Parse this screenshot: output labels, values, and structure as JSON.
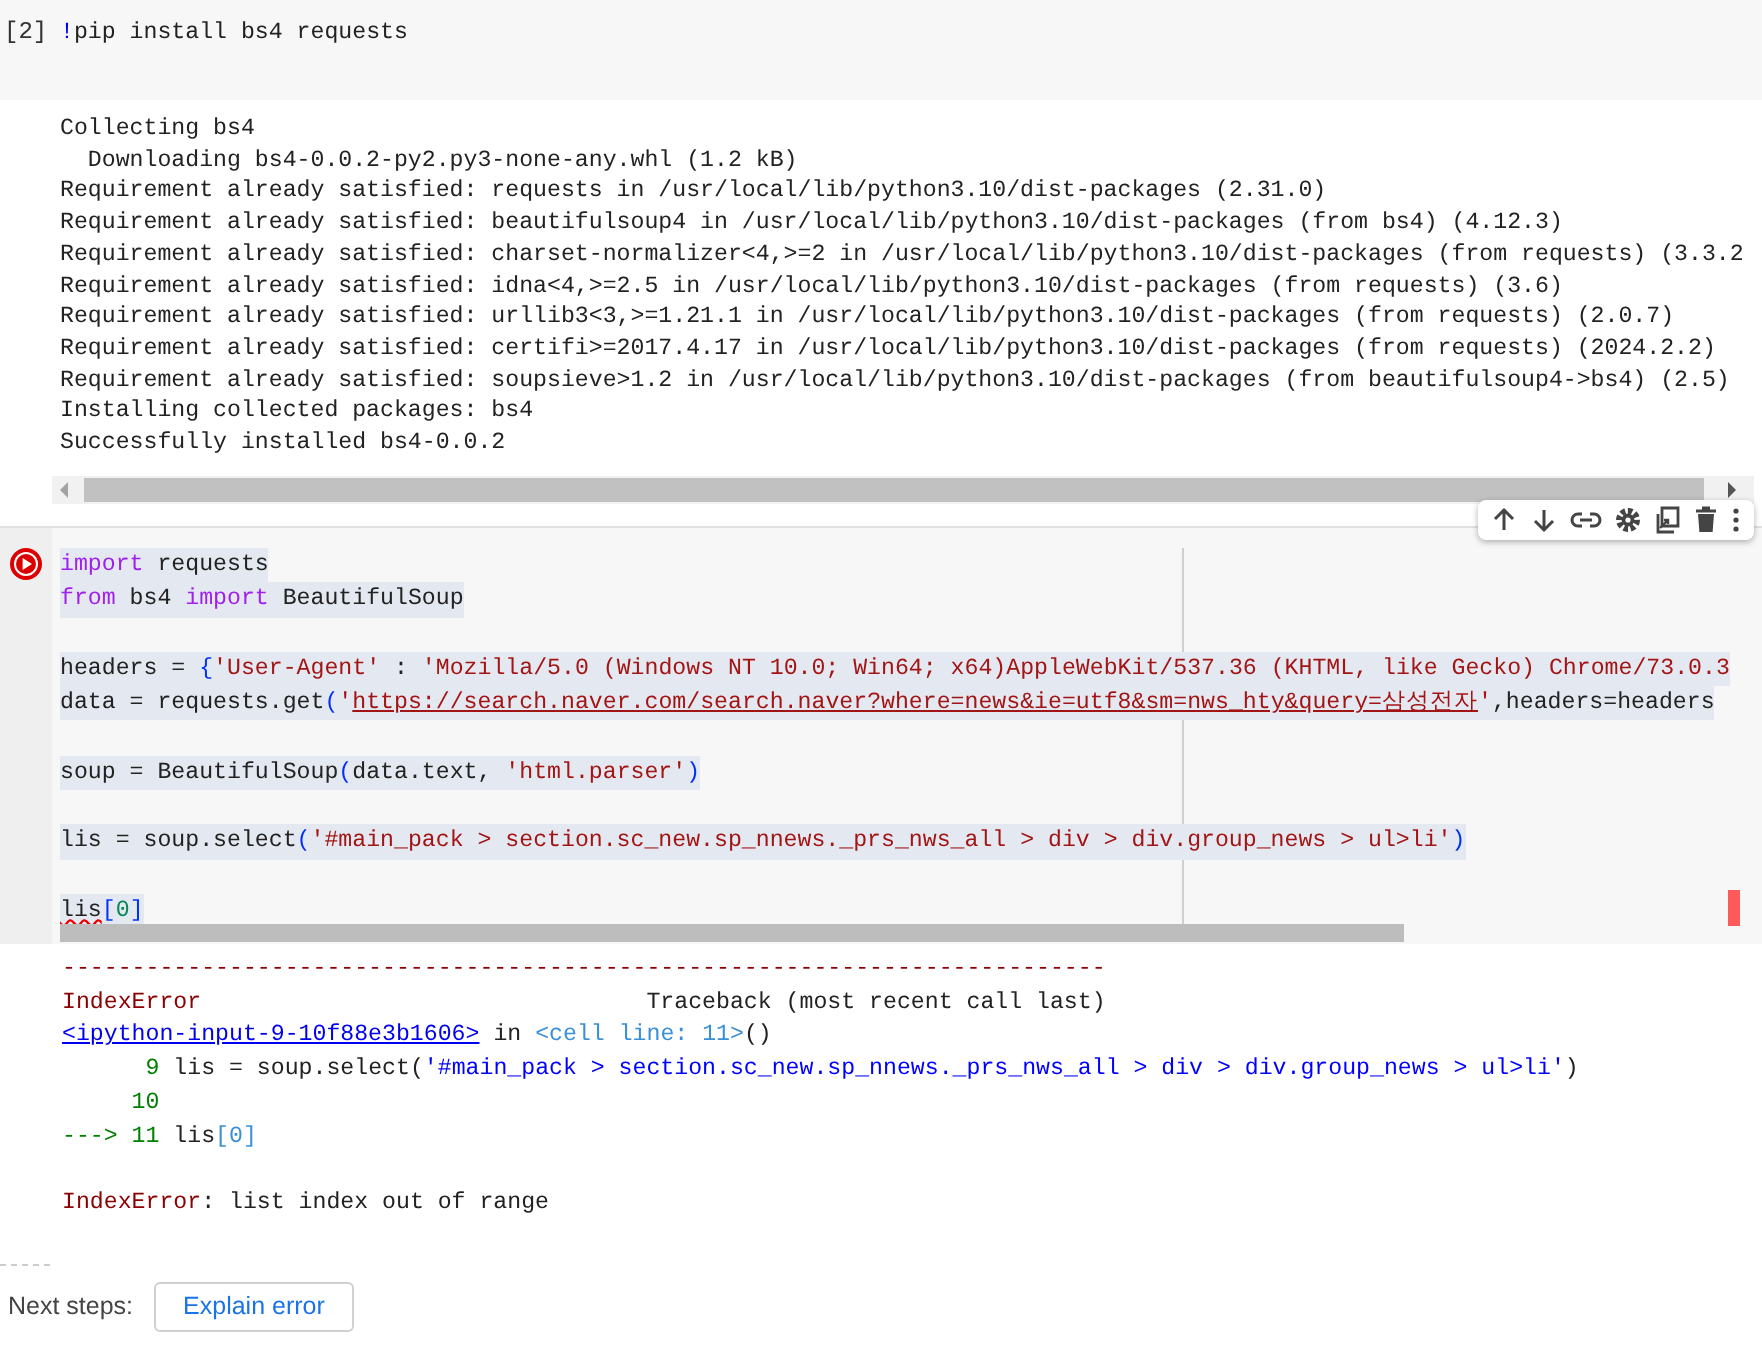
{
  "pip_cell": {
    "execution_count": "[2]",
    "tokens": [
      {
        "kind": "magic",
        "text": "!"
      },
      {
        "kind": "plain",
        "text": "pip install bs4 requests"
      }
    ]
  },
  "pip_output": [
    "Collecting bs4",
    "  Downloading bs4-0.0.2-py2.py3-none-any.whl (1.2 kB)",
    "Requirement already satisfied: requests in /usr/local/lib/python3.10/dist-packages (2.31.0)",
    "Requirement already satisfied: beautifulsoup4 in /usr/local/lib/python3.10/dist-packages (from bs4) (4.12.3)",
    "Requirement already satisfied: charset-normalizer<4,>=2 in /usr/local/lib/python3.10/dist-packages (from requests) (3.3.2",
    "Requirement already satisfied: idna<4,>=2.5 in /usr/local/lib/python3.10/dist-packages (from requests) (3.6)",
    "Requirement already satisfied: urllib3<3,>=1.21.1 in /usr/local/lib/python3.10/dist-packages (from requests) (2.0.7)",
    "Requirement already satisfied: certifi>=2017.4.17 in /usr/local/lib/python3.10/dist-packages (from requests) (2024.2.2)",
    "Requirement already satisfied: soupsieve>1.2 in /usr/local/lib/python3.10/dist-packages (from beautifulsoup4->bs4) (2.5)",
    "Installing collected packages: bs4",
    "Successfully installed bs4-0.0.2"
  ],
  "code_cell": {
    "error_marker": true,
    "lines": [
      {
        "blank_after": false,
        "tokens": [
          {
            "kind": "keyword",
            "text": "import"
          },
          {
            "kind": "plain",
            "text": " requests"
          }
        ]
      },
      {
        "blank_after": true,
        "tokens": [
          {
            "kind": "keyword",
            "text": "from"
          },
          {
            "kind": "plain",
            "text": " bs4 "
          },
          {
            "kind": "keyword",
            "text": "import"
          },
          {
            "kind": "plain",
            "text": " BeautifulSoup"
          }
        ]
      },
      {
        "blank_after": false,
        "tokens": [
          {
            "kind": "plain",
            "text": "headers = "
          },
          {
            "kind": "bracket",
            "text": "{"
          },
          {
            "kind": "string",
            "text": "'User-Agent'"
          },
          {
            "kind": "plain",
            "text": " : "
          },
          {
            "kind": "string",
            "text": "'Mozilla/5.0 (Windows NT 10.0; Win64; x64)AppleWebKit/537.36 (KHTML, like Gecko) Chrome/73.0.3"
          }
        ]
      },
      {
        "blank_after": true,
        "tokens": [
          {
            "kind": "plain",
            "text": "data = requests.get"
          },
          {
            "kind": "bracket",
            "text": "("
          },
          {
            "kind": "string",
            "text": "'"
          },
          {
            "kind": "url",
            "text": "https://search.naver.com/search.naver?where=news&ie=utf8&sm=nws_hty&query=삼성전자"
          },
          {
            "kind": "string",
            "text": "'"
          },
          {
            "kind": "plain",
            "text": ",headers=headers"
          }
        ]
      },
      {
        "blank_after": true,
        "tokens": [
          {
            "kind": "plain",
            "text": "soup = BeautifulSoup"
          },
          {
            "kind": "bracket",
            "text": "("
          },
          {
            "kind": "plain",
            "text": "data.text, "
          },
          {
            "kind": "string",
            "text": "'html.parser'"
          },
          {
            "kind": "bracket",
            "text": ")"
          }
        ]
      },
      {
        "blank_after": true,
        "tokens": [
          {
            "kind": "plain",
            "text": "lis = soup.select"
          },
          {
            "kind": "bracket",
            "text": "("
          },
          {
            "kind": "string",
            "text": "'#main_pack > section.sc_new.sp_nnews._prs_nws_all > div > div.group_news > ul>li'"
          },
          {
            "kind": "bracket",
            "text": ")"
          }
        ]
      },
      {
        "blank_after": false,
        "tokens": [
          {
            "kind": "squiggle",
            "text": "lis"
          },
          {
            "kind": "bracket",
            "text": "["
          },
          {
            "kind": "number",
            "text": "0"
          },
          {
            "kind": "bracket",
            "text": "]"
          }
        ]
      }
    ]
  },
  "traceback": [
    {
      "blank_after": false,
      "tokens": [
        {
          "kind": "error",
          "text": "---------------------------------------------------------------------------"
        }
      ]
    },
    {
      "blank_after": false,
      "tokens": [
        {
          "kind": "error",
          "text": "IndexError"
        },
        {
          "kind": "plain",
          "text": "                                Traceback (most recent call last)"
        }
      ]
    },
    {
      "blank_after": false,
      "tokens": [
        {
          "kind": "link",
          "text": "<ipython-input-9-10f88e3b1606>"
        },
        {
          "kind": "plain",
          "text": " in "
        },
        {
          "kind": "cellref",
          "text": "<cell line: 11>"
        },
        {
          "kind": "plain",
          "text": "()"
        }
      ]
    },
    {
      "blank_after": false,
      "tokens": [
        {
          "kind": "lineno",
          "text": "      9 "
        },
        {
          "kind": "plain",
          "text": "lis = soup.select("
        },
        {
          "kind": "code",
          "text": "'#main_pack > section.sc_new.sp_nnews._prs_nws_all > div > div.group_news > ul>li'"
        },
        {
          "kind": "plain",
          "text": ")"
        }
      ]
    },
    {
      "blank_after": false,
      "tokens": [
        {
          "kind": "lineno",
          "text": "     10"
        }
      ]
    },
    {
      "blank_after": true,
      "tokens": [
        {
          "kind": "lineno",
          "text": "---> 11 "
        },
        {
          "kind": "plain",
          "text": "lis"
        },
        {
          "kind": "cellref",
          "text": "[0]"
        }
      ]
    },
    {
      "blank_after": false,
      "tokens": [
        {
          "kind": "error",
          "text": "IndexError"
        },
        {
          "kind": "plain",
          "text": ": list index out of range"
        }
      ]
    }
  ],
  "next_steps": {
    "label": "Next steps:",
    "button": "Explain error"
  }
}
